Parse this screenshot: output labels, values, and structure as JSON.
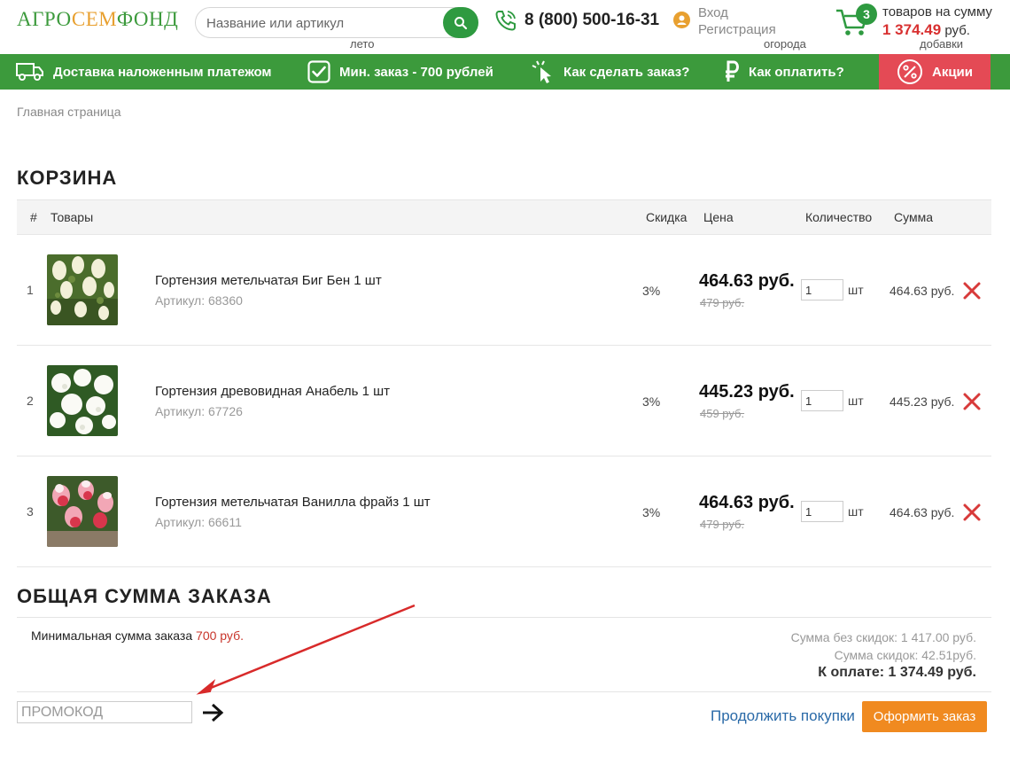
{
  "header": {
    "logo_part1": "АГРО",
    "logo_part2": "СЕМ",
    "logo_part3": "ФОНД",
    "search_placeholder": "Название или артикул",
    "phone": "8 (800) 500-16-31",
    "login_label": "Вход",
    "register_label": "Регистрация",
    "cart_count": "3",
    "cart_text": "товаров на сумму",
    "cart_sum": "1 374.49",
    "cart_currency": "руб.",
    "nav_hints": [
      "лето",
      "огорода",
      "добавки"
    ]
  },
  "greenbar": {
    "delivery": "Доставка наложенным платежом",
    "min_order": "Мин. заказ - 700 рублей",
    "how_order": "Как сделать заказ?",
    "how_pay": "Как оплатить?",
    "promo": "Акции"
  },
  "breadcrumb": "Главная страница",
  "cart": {
    "title": "Корзина",
    "columns": {
      "num": "#",
      "goods": "Товары",
      "discount": "Скидка",
      "price": "Цена",
      "qty": "Количество",
      "sum": "Сумма"
    },
    "rows": [
      {
        "num": "1",
        "title": "Гортензия метельчатая Биг Бен 1 шт",
        "article": "Артикул: 68360",
        "discount": "3%",
        "price": "464.63 руб.",
        "old_price": "479 руб.",
        "qty": "1",
        "unit": "шт",
        "sum": "464.63 руб."
      },
      {
        "num": "2",
        "title": "Гортензия древовидная Анабель 1 шт",
        "article": "Артикул: 67726",
        "discount": "3%",
        "price": "445.23 руб.",
        "old_price": "459 руб.",
        "qty": "1",
        "unit": "шт",
        "sum": "445.23 руб."
      },
      {
        "num": "3",
        "title": "Гортензия метельчатая Ванилла фрайз 1 шт",
        "article": "Артикул: 66611",
        "discount": "3%",
        "price": "464.63 руб.",
        "old_price": "479 руб.",
        "qty": "1",
        "unit": "шт",
        "sum": "464.63 руб."
      }
    ]
  },
  "total": {
    "title": "Общая сумма заказа",
    "min_label": "Минимальная сумма заказа",
    "min_value": "700 руб.",
    "no_discount": "Сумма без скидок: 1 417.00 руб.",
    "discount_sum": "Сумма скидок: 42.51руб.",
    "to_pay": "К оплате: 1 374.49 руб."
  },
  "footer": {
    "promo_placeholder": "ПРОМОКОД",
    "continue": "Продолжить покупки",
    "checkout": "Оформить заказ"
  },
  "colors": {
    "brand_green": "#3c9a3c",
    "accent_red": "#e44a55",
    "checkout_orange": "#f08a20"
  }
}
